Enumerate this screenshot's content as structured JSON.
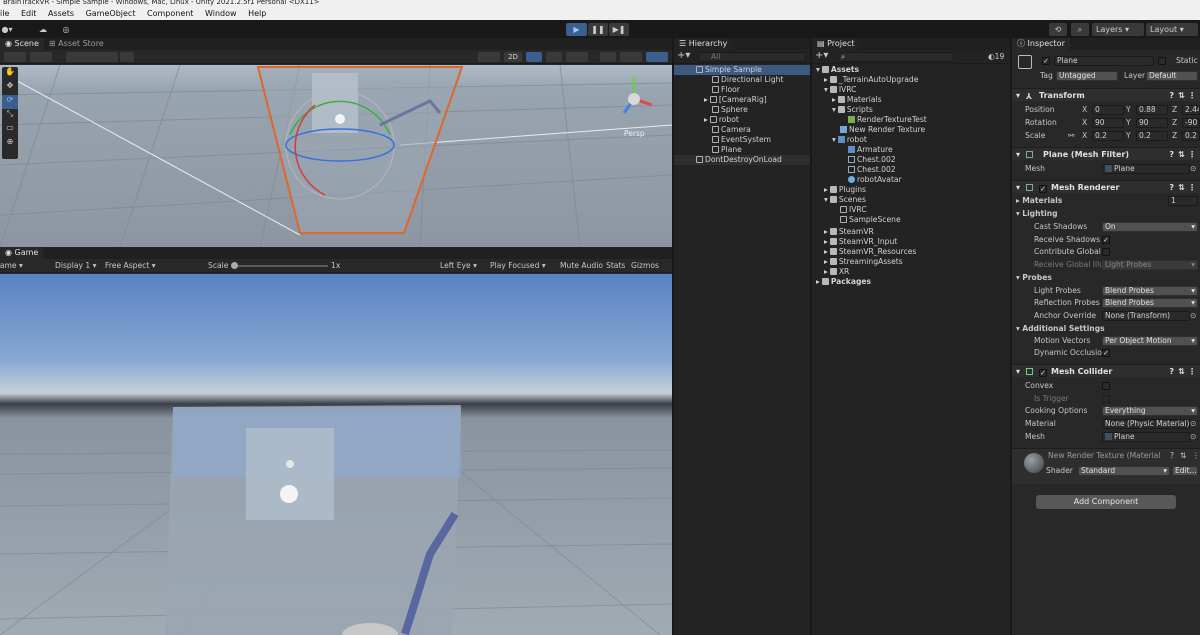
{
  "window": {
    "title": "BrainTrackVR - Simple Sample - Windows, Mac, Linux - Unity 2021.2.5f1 Personal <DX11>"
  },
  "menu": [
    "File",
    "Edit",
    "Assets",
    "GameObject",
    "Component",
    "Window",
    "Help"
  ],
  "toolbar": {
    "layers": "Layers",
    "layout": "Layout"
  },
  "scene": {
    "tabs": [
      "Scene",
      "Asset Store"
    ],
    "toggle_2d": "2D",
    "gizmo_label": "Persp"
  },
  "game": {
    "tab": "Game",
    "display": "Game",
    "display_num": "Display 1",
    "aspect": "Free Aspect",
    "scale_label": "Scale",
    "scale_value": "1x",
    "eye": "Left Eye",
    "play_mode": "Play Focused",
    "mute": "Mute Audio",
    "stats": "Stats",
    "gizmos": "Gizmos"
  },
  "hierarchy": {
    "tab": "Hierarchy",
    "search_placeholder": "All",
    "items": [
      {
        "label": "Simple Sample"
      },
      {
        "label": "Directional Light"
      },
      {
        "label": "Floor"
      },
      {
        "label": "[CameraRig]"
      },
      {
        "label": "Sphere"
      },
      {
        "label": "robot"
      },
      {
        "label": "Camera"
      },
      {
        "label": "EventSystem"
      },
      {
        "label": "Plane"
      },
      {
        "label": "DontDestroyOnLoad"
      }
    ]
  },
  "project": {
    "tab": "Project",
    "hidden_count": "19",
    "items": [
      {
        "label": "Assets"
      },
      {
        "label": "_TerrainAutoUpgrade"
      },
      {
        "label": "IVRC"
      },
      {
        "label": "Materials"
      },
      {
        "label": "Scripts"
      },
      {
        "label": "RenderTextureTest"
      },
      {
        "label": "New Render Texture"
      },
      {
        "label": "robot"
      },
      {
        "label": "Armature"
      },
      {
        "label": "Chest.002"
      },
      {
        "label": "Chest.002"
      },
      {
        "label": "robotAvatar"
      },
      {
        "label": "Plugins"
      },
      {
        "label": "Scenes"
      },
      {
        "label": "IVRC"
      },
      {
        "label": "SampleScene"
      },
      {
        "label": "SteamVR"
      },
      {
        "label": "SteamVR_Input"
      },
      {
        "label": "SteamVR_Resources"
      },
      {
        "label": "StreamingAssets"
      },
      {
        "label": "XR"
      },
      {
        "label": "Packages"
      }
    ]
  },
  "inspector": {
    "tab": "Inspector",
    "object_name": "Plane",
    "static_label": "Static",
    "tag_label": "Tag",
    "tag_value": "Untagged",
    "layer_label": "Layer",
    "layer_value": "Default",
    "transform": {
      "title": "Transform",
      "position_label": "Position",
      "rotation_label": "Rotation",
      "scale_label": "Scale",
      "position": {
        "x": "0",
        "y": "0.88",
        "z": "2.44"
      },
      "rotation": {
        "x": "90",
        "y": "90",
        "z": "-90"
      },
      "scale": {
        "x": "0.2",
        "y": "0.2",
        "z": "0.2"
      }
    },
    "mesh_filter": {
      "title": "Plane (Mesh Filter)",
      "mesh_label": "Mesh",
      "mesh_value": "Plane"
    },
    "mesh_renderer": {
      "title": "Mesh Renderer",
      "materials_label": "Materials",
      "materials_count": "1",
      "lighting_label": "Lighting",
      "cast_shadows_label": "Cast Shadows",
      "cast_shadows_value": "On",
      "receive_shadows_label": "Receive Shadows",
      "contribute_gi_label": "Contribute Global I",
      "receive_gi_label": "Receive Global Illu",
      "receive_gi_value": "Light Probes",
      "probes_label": "Probes",
      "light_probes_label": "Light Probes",
      "light_probes_value": "Blend Probes",
      "reflection_probes_label": "Reflection Probes",
      "reflection_probes_value": "Blend Probes",
      "anchor_override_label": "Anchor Override",
      "anchor_override_value": "None (Transform)",
      "additional_label": "Additional Settings",
      "motion_vectors_label": "Motion Vectors",
      "motion_vectors_value": "Per Object Motion",
      "dynamic_occlusion_label": "Dynamic Occlusio"
    },
    "mesh_collider": {
      "title": "Mesh Collider",
      "convex_label": "Convex",
      "is_trigger_label": "Is Trigger",
      "cooking_label": "Cooking Options",
      "cooking_value": "Everything",
      "material_label": "Material",
      "material_value": "None (Physic Material)",
      "mesh_label": "Mesh",
      "mesh_value": "Plane"
    },
    "material": {
      "name": "New Render Texture (Material",
      "shader_label": "Shader",
      "shader_value": "Standard",
      "edit_label": "Edit..."
    },
    "add_component": "Add Component"
  },
  "colors": {
    "accent": "#4a8ad6",
    "selection": "#3c5a80",
    "orange_outline": "#e0672a"
  }
}
